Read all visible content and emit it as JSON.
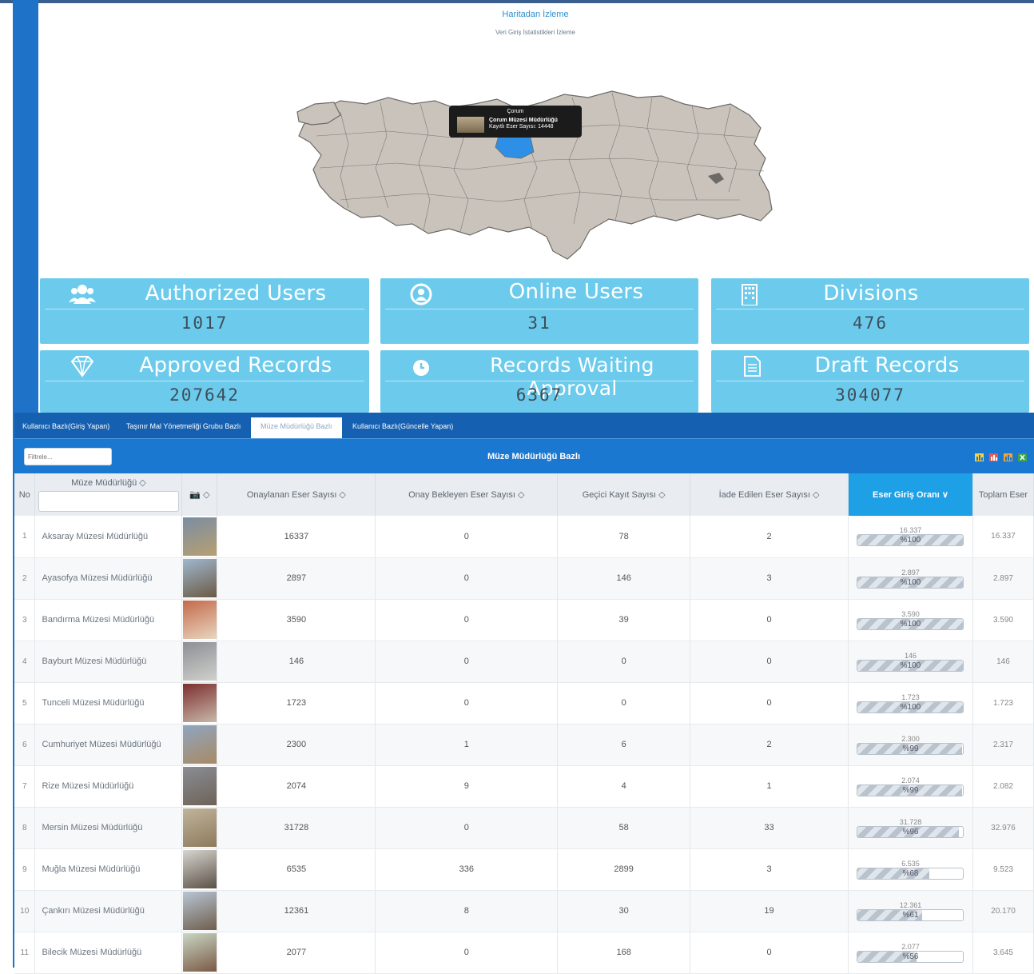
{
  "map": {
    "title": "Haritadan İzleme",
    "subtitle": "Veri Giriş İstatistikleri İzleme",
    "tooltip": {
      "city": "Çorum",
      "museum": "Çorum Müzesi Müdürlüğü",
      "count_label": "Kayıtlı Eser Sayısı: 14448"
    },
    "highlight_color": "#2e8fe6"
  },
  "cards": [
    {
      "label": "Authorized Users",
      "value": "1017",
      "icon": "users-icon"
    },
    {
      "label": "Online Users",
      "value": "31",
      "icon": "user-circle-icon"
    },
    {
      "label": "Divisions",
      "value": "476",
      "icon": "building-icon"
    },
    {
      "label": "Approved  Records",
      "value": "207642",
      "icon": "diamond-icon"
    },
    {
      "label": "Records Waiting Approval",
      "value": "6367",
      "icon": "clock-icon"
    },
    {
      "label": "Draft Records",
      "value": "304077",
      "icon": "document-icon"
    }
  ],
  "tabs": [
    {
      "label": "Kullanıcı Bazlı(Giriş Yapan)"
    },
    {
      "label": "Taşınır Mal Yönetmeliği Grubu Bazlı"
    },
    {
      "label": "Müze Müdürlüğü Bazlı"
    },
    {
      "label": "Kullanıcı Bazlı(Güncelle Yapan)"
    }
  ],
  "active_tab": "Müze Müdürlüğü Bazlı",
  "table_bar": {
    "filter_placeholder": "Filtrele...",
    "caption": "Müze Müdürlüğü Bazlı"
  },
  "columns": {
    "no": "No",
    "name": "Müze Müdürlüğü ◇",
    "photo": "◇",
    "approved": "Onaylanan Eser Sayısı ◇",
    "waiting": "Onay Bekleyen Eser Sayısı ◇",
    "temp": "Geçici Kayıt Sayısı ◇",
    "returned": "İade Edilen Eser Sayısı ◇",
    "rate": "Eser Giriş Oranı ∨",
    "total": "Toplam Eser"
  },
  "rows": [
    {
      "no": "1",
      "name": "Aksaray Müzesi Müdürlüğü",
      "approved": "16337",
      "waiting": "0",
      "temp": "78",
      "returned": "2",
      "rate_top": "16.337",
      "rate_pct": "%100",
      "rate": 1.0,
      "total": "16.337"
    },
    {
      "no": "2",
      "name": "Ayasofya Müzesi Müdürlüğü",
      "approved": "2897",
      "waiting": "0",
      "temp": "146",
      "returned": "3",
      "rate_top": "2.897",
      "rate_pct": "%100",
      "rate": 1.0,
      "total": "2.897"
    },
    {
      "no": "3",
      "name": "Bandırma Müzesi Müdürlüğü",
      "approved": "3590",
      "waiting": "0",
      "temp": "39",
      "returned": "0",
      "rate_top": "3.590",
      "rate_pct": "%100",
      "rate": 1.0,
      "total": "3.590"
    },
    {
      "no": "4",
      "name": "Bayburt Müzesi Müdürlüğü",
      "approved": "146",
      "waiting": "0",
      "temp": "0",
      "returned": "0",
      "rate_top": "146",
      "rate_pct": "%100",
      "rate": 1.0,
      "total": "146"
    },
    {
      "no": "5",
      "name": "Tunceli Müzesi Müdürlüğü",
      "approved": "1723",
      "waiting": "0",
      "temp": "0",
      "returned": "0",
      "rate_top": "1.723",
      "rate_pct": "%100",
      "rate": 1.0,
      "total": "1.723"
    },
    {
      "no": "6",
      "name": "Cumhuriyet Müzesi Müdürlüğü",
      "approved": "2300",
      "waiting": "1",
      "temp": "6",
      "returned": "2",
      "rate_top": "2.300",
      "rate_pct": "%99",
      "rate": 0.99,
      "total": "2.317"
    },
    {
      "no": "7",
      "name": "Rize Müzesi Müdürlüğü",
      "approved": "2074",
      "waiting": "9",
      "temp": "4",
      "returned": "1",
      "rate_top": "2.074",
      "rate_pct": "%99",
      "rate": 0.99,
      "total": "2.082"
    },
    {
      "no": "8",
      "name": "Mersin Müzesi Müdürlüğü",
      "approved": "31728",
      "waiting": "0",
      "temp": "58",
      "returned": "33",
      "rate_top": "31.728",
      "rate_pct": "%96",
      "rate": 0.96,
      "total": "32.976"
    },
    {
      "no": "9",
      "name": "Muğla Müzesi Müdürlüğü",
      "approved": "6535",
      "waiting": "336",
      "temp": "2899",
      "returned": "3",
      "rate_top": "6.535",
      "rate_pct": "%68",
      "rate": 0.68,
      "total": "9.523"
    },
    {
      "no": "10",
      "name": "Çankırı Müzesi Müdürlüğü",
      "approved": "12361",
      "waiting": "8",
      "temp": "30",
      "returned": "19",
      "rate_top": "12.361",
      "rate_pct": "%61",
      "rate": 0.61,
      "total": "20.170"
    },
    {
      "no": "11",
      "name": "Bilecik Müzesi Müdürlüğü",
      "approved": "2077",
      "waiting": "0",
      "temp": "168",
      "returned": "0",
      "rate_top": "2.077",
      "rate_pct": "%56",
      "rate": 0.56,
      "total": "3.645"
    }
  ]
}
